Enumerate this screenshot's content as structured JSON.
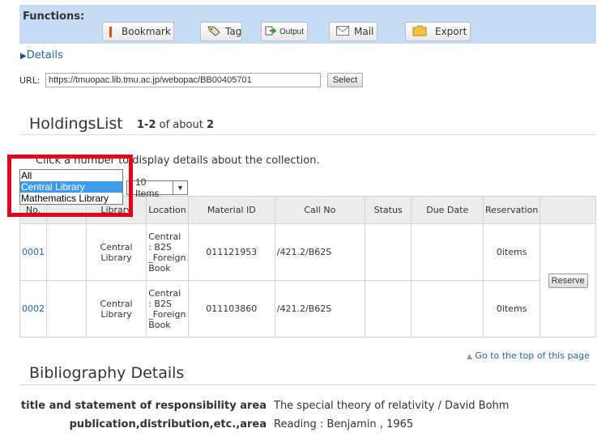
{
  "functions": {
    "label": "Functions:",
    "buttons": [
      {
        "label": "Bookmark",
        "icon": "bookmark-icon"
      },
      {
        "label": "Tag",
        "icon": "tag-icon"
      },
      {
        "label": "Output",
        "icon": "output-icon"
      },
      {
        "label": "Mail",
        "icon": "mail-icon"
      },
      {
        "label": "Export",
        "icon": "export-icon"
      }
    ]
  },
  "details": {
    "label": "Details"
  },
  "url": {
    "label": "URL:",
    "value": "https://tmuopac.lib.tmu.ac.jp/webopac/BB00405701",
    "select_label": "Select"
  },
  "holdings": {
    "title": "HoldingsList",
    "range_start": "1",
    "range_sep": "-",
    "range_end": "2",
    "range_of": " of about ",
    "total": "2",
    "instruction": "Click a number to display details about the collection.",
    "items_select": "10 Items",
    "library_dropdown": {
      "options": [
        "All",
        "Central Library",
        "Mathematics Library"
      ],
      "selected": "Central Library"
    },
    "columns": [
      "No.",
      "",
      "Library",
      "Location",
      "Material ID",
      "Call No",
      "Status",
      "Due Date",
      "Reservation",
      ""
    ],
    "rows": [
      {
        "no": "0001",
        "library": "Central Library",
        "location": "Central : B2S _Foreign Book",
        "material_id": "011121953",
        "call_no": "/421.2/B62S",
        "status": "",
        "due_date": "",
        "reservation": "0items"
      },
      {
        "no": "0002",
        "library": "Central Library",
        "location": "Central : B2S _Foreign Book",
        "material_id": "011103860",
        "call_no": "/421.2/B62S",
        "status": "",
        "due_date": "",
        "reservation": "0items"
      }
    ],
    "reserve_label": "Reserve"
  },
  "goto_top": "Go to the top of this page",
  "bibliography": {
    "title": "Bibliography Details",
    "fields": [
      {
        "label": "title and statement of responsibility area",
        "value": "The special theory of relativity / David Bohm"
      },
      {
        "label": "publication,distribution,etc.,area",
        "value": "Reading : Benjamin , 1965"
      }
    ]
  },
  "colors": {
    "functions_bg": "#c6dcf4",
    "link": "#2266aa",
    "highlight": "#e3001b",
    "selected_option": "#3d9be9"
  }
}
